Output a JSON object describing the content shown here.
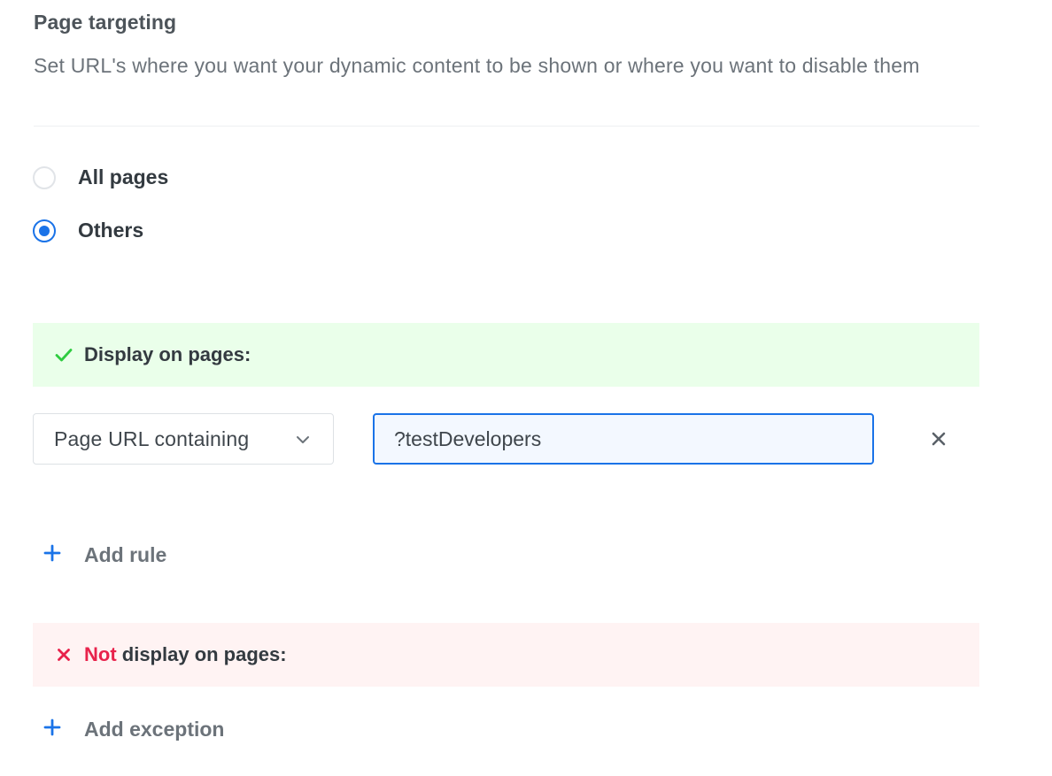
{
  "section": {
    "title": "Page targeting",
    "description": "Set URL's where you want your dynamic content to be shown or where you want to disable them"
  },
  "targeting_options": [
    {
      "label": "All pages",
      "selected": false
    },
    {
      "label": "Others",
      "selected": true
    }
  ],
  "display_rules": {
    "banner_label": "Display on pages:",
    "rule": {
      "condition_value": "Page URL containing",
      "url_value": "?testDevelopers"
    },
    "add_label": "Add rule"
  },
  "exception_rules": {
    "banner_prefix": "Not",
    "banner_suffix": " display on pages:",
    "add_label": "Add exception"
  },
  "icons": {
    "check": "checkmark-icon",
    "cross": "cross-icon",
    "plus": "plus-icon",
    "chevron": "chevron-down-icon",
    "close": "close-icon"
  },
  "colors": {
    "accent": "#1a73e8",
    "success": "#2ecc40",
    "danger": "#e8224b",
    "success_bg": "#eaffea",
    "danger_bg": "#fff3f3"
  }
}
